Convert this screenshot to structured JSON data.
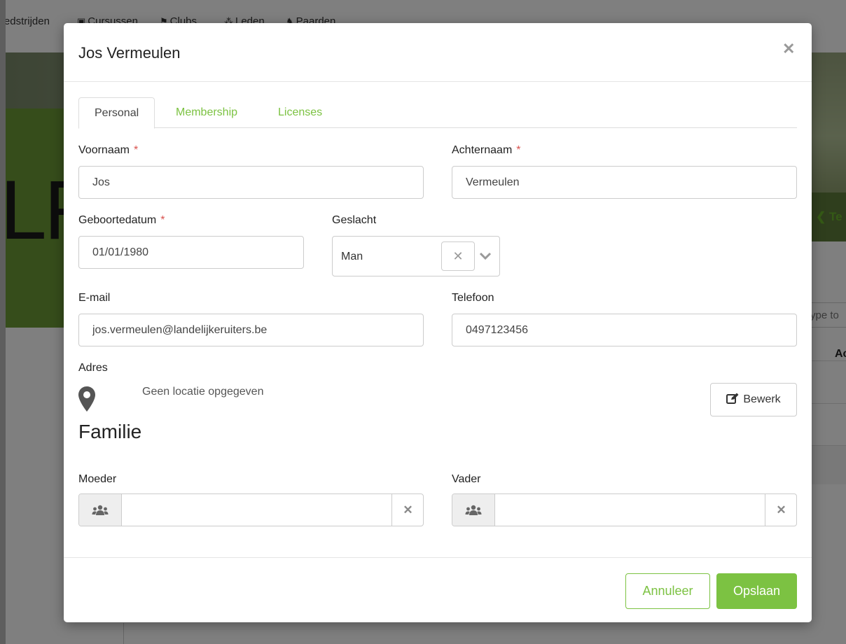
{
  "background": {
    "nav_items": [
      {
        "icon": "trophy-icon",
        "label": "Wedstrijden"
      },
      {
        "icon": "book-icon",
        "label": "Cursussen"
      },
      {
        "icon": "flag-icon",
        "label": "Clubs"
      },
      {
        "icon": "users-icon",
        "label": "Leden"
      },
      {
        "icon": "horse-icon",
        "label": "Paarden"
      }
    ],
    "big_text": "LR",
    "back_link": "❮ Te",
    "search_placeholder": "ype to",
    "column_header": "Ac"
  },
  "modal": {
    "title": "Jos Vermeulen",
    "close_icon": "close-icon",
    "tabs": [
      {
        "label": "Personal",
        "active": true
      },
      {
        "label": "Membership",
        "active": false
      },
      {
        "label": "Licenses",
        "active": false
      }
    ],
    "required_marker": "*",
    "fields": {
      "voornaam": {
        "label": "Voornaam",
        "value": "Jos",
        "required": true
      },
      "achternaam": {
        "label": "Achternaam",
        "value": "Vermeulen",
        "required": true
      },
      "geboortedatum": {
        "label": "Geboortedatum",
        "value": "01/01/1980",
        "required": true
      },
      "geslacht": {
        "label": "Geslacht",
        "value": "Man"
      },
      "email": {
        "label": "E-mail",
        "value": "jos.vermeulen@landelijkeruiters.be"
      },
      "telefoon": {
        "label": "Telefoon",
        "value": "0497123456"
      }
    },
    "adres": {
      "label": "Adres",
      "icon": "map-marker-icon",
      "text": "Geen locatie opgegeven",
      "edit_button": "Bewerk",
      "edit_icon": "edit-icon"
    },
    "familie": {
      "title": "Familie",
      "moeder": {
        "label": "Moeder",
        "value": "",
        "icon": "users-icon"
      },
      "vader": {
        "label": "Vader",
        "value": "",
        "icon": "users-icon"
      }
    },
    "footer": {
      "cancel_label": "Annuleer",
      "save_label": "Opslaan"
    }
  },
  "colors": {
    "accent": "#7cc242",
    "required": "#d9534f",
    "overlay": "rgba(0,0,0,0.5)"
  }
}
